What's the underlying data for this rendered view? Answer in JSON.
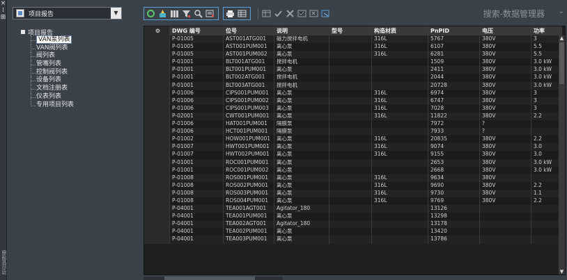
{
  "palette": {
    "close_glyph": "×",
    "pin_glyph": "⁞",
    "props_glyph": "⊞",
    "vertical_title": "项目管理器"
  },
  "left": {
    "project_select": "项目报告",
    "tree_root": "项目报告",
    "tree_items": [
      "VAN泵列表",
      "VAN阀列表",
      "阀列表",
      "管嘴列表",
      "控制阀列表",
      "设备列表",
      "文档注册表",
      "仪表列表",
      "专用项目列表"
    ],
    "selected_index": 0
  },
  "toolbar": {
    "search_placeholder": "搜索-数据管理器",
    "search_dropdown": "⌄"
  },
  "grid": {
    "columns": [
      "",
      "DWG 编号",
      "位号",
      "说明",
      "型号",
      "构造材质",
      "PnPID",
      "电压",
      "功率"
    ],
    "rows": [
      [
        "P-01005",
        "AST001ATG001",
        "磁力搅拌电机",
        "",
        "316L",
        "5767",
        "380V",
        "3"
      ],
      [
        "P-01005",
        "AST001PUM001",
        "离心泵",
        "",
        "316L",
        "6107",
        "380V",
        "5.5"
      ],
      [
        "P-01005",
        "AST001PUM002",
        "离心泵",
        "",
        "316L",
        "6281",
        "380V",
        "5.5"
      ],
      [
        "P-01001",
        "BLT001ATG001",
        "搅拌电机",
        "",
        "",
        "1509",
        "380V",
        "3.0 kW"
      ],
      [
        "P-01001",
        "BLT001PUM001",
        "离心泵",
        "",
        "",
        "2411",
        "380V",
        "3.0 kW"
      ],
      [
        "P-01001",
        "BLT002ATG001",
        "搅拌电机",
        "",
        "",
        "2044",
        "380V",
        "3.0 kW"
      ],
      [
        "P-01001",
        "BLT003ATG001",
        "搅拌电机",
        "",
        "",
        "20728",
        "380V",
        "3.0 kW"
      ],
      [
        "P-01006",
        "CIPS001PUM001",
        "离心泵",
        "",
        "316L",
        "6974",
        "380V",
        "3"
      ],
      [
        "P-01006",
        "CIPS001PUM002",
        "离心泵",
        "",
        "316L",
        "6747",
        "380V",
        "3"
      ],
      [
        "P-01006",
        "CIPS001PUM003",
        "离心泵",
        "",
        "316L",
        "7028",
        "380V",
        "3"
      ],
      [
        "P-02001",
        "CWT001PUM001",
        "离心泵",
        "",
        "316L",
        "11822",
        "380V",
        "2.2"
      ],
      [
        "P-01006",
        "HAT001PUM001",
        "隔膜泵",
        "",
        "",
        "7972",
        "?",
        ""
      ],
      [
        "P-01006",
        "HCT001PUM001",
        "隔膜泵",
        "",
        "",
        "7933",
        "?",
        ""
      ],
      [
        "P-01002",
        "HOW001PUM001",
        "离心泵",
        "",
        "316L",
        "20835",
        "380V",
        "2.2"
      ],
      [
        "P-01007",
        "HWT001PUM001",
        "离心泵",
        "",
        "316L",
        "9074",
        "380V",
        "3.0"
      ],
      [
        "P-01007",
        "HWT002PUM001",
        "离心泵",
        "",
        "316L",
        "9155",
        "380V",
        "3.0"
      ],
      [
        "P-01001",
        "ROC001PUM001",
        "离心泵",
        "",
        "",
        "2653",
        "380V",
        "3.0 kW"
      ],
      [
        "P-01001",
        "ROC001PUM002",
        "离心泵",
        "",
        "",
        "2668",
        "380V",
        "3.0 kW"
      ],
      [
        "P-01008",
        "ROS001PUM001",
        "离心泵",
        "",
        "316L",
        "9634",
        "380V",
        ""
      ],
      [
        "P-01008",
        "ROS002PUM001",
        "离心泵",
        "",
        "316L",
        "9690",
        "380V",
        "2.2"
      ],
      [
        "P-01008",
        "ROS003PUM001",
        "离心泵",
        "",
        "316L",
        "9730",
        "380V",
        "1.1"
      ],
      [
        "P-01008",
        "ROS004PUM001",
        "离心泵",
        "",
        "316L",
        "9769",
        "380V",
        "2.2"
      ],
      [
        "P-04001",
        "TEA001AGT001",
        "Agitator_180",
        "",
        "",
        "13126",
        "",
        ""
      ],
      [
        "P-04001",
        "TEA001PUM001",
        "离心泵",
        "",
        "",
        "13298",
        "",
        ""
      ],
      [
        "P-04001",
        "TEA002AGT001",
        "Agitator_180",
        "",
        "",
        "13178",
        "",
        ""
      ],
      [
        "P-04001",
        "TEA002PUM001",
        "离心泵",
        "",
        "",
        "13420",
        "",
        ""
      ],
      [
        "P-04001",
        "TEA003PUM001",
        "离心泵",
        "",
        "",
        "13786",
        "",
        ""
      ]
    ]
  }
}
